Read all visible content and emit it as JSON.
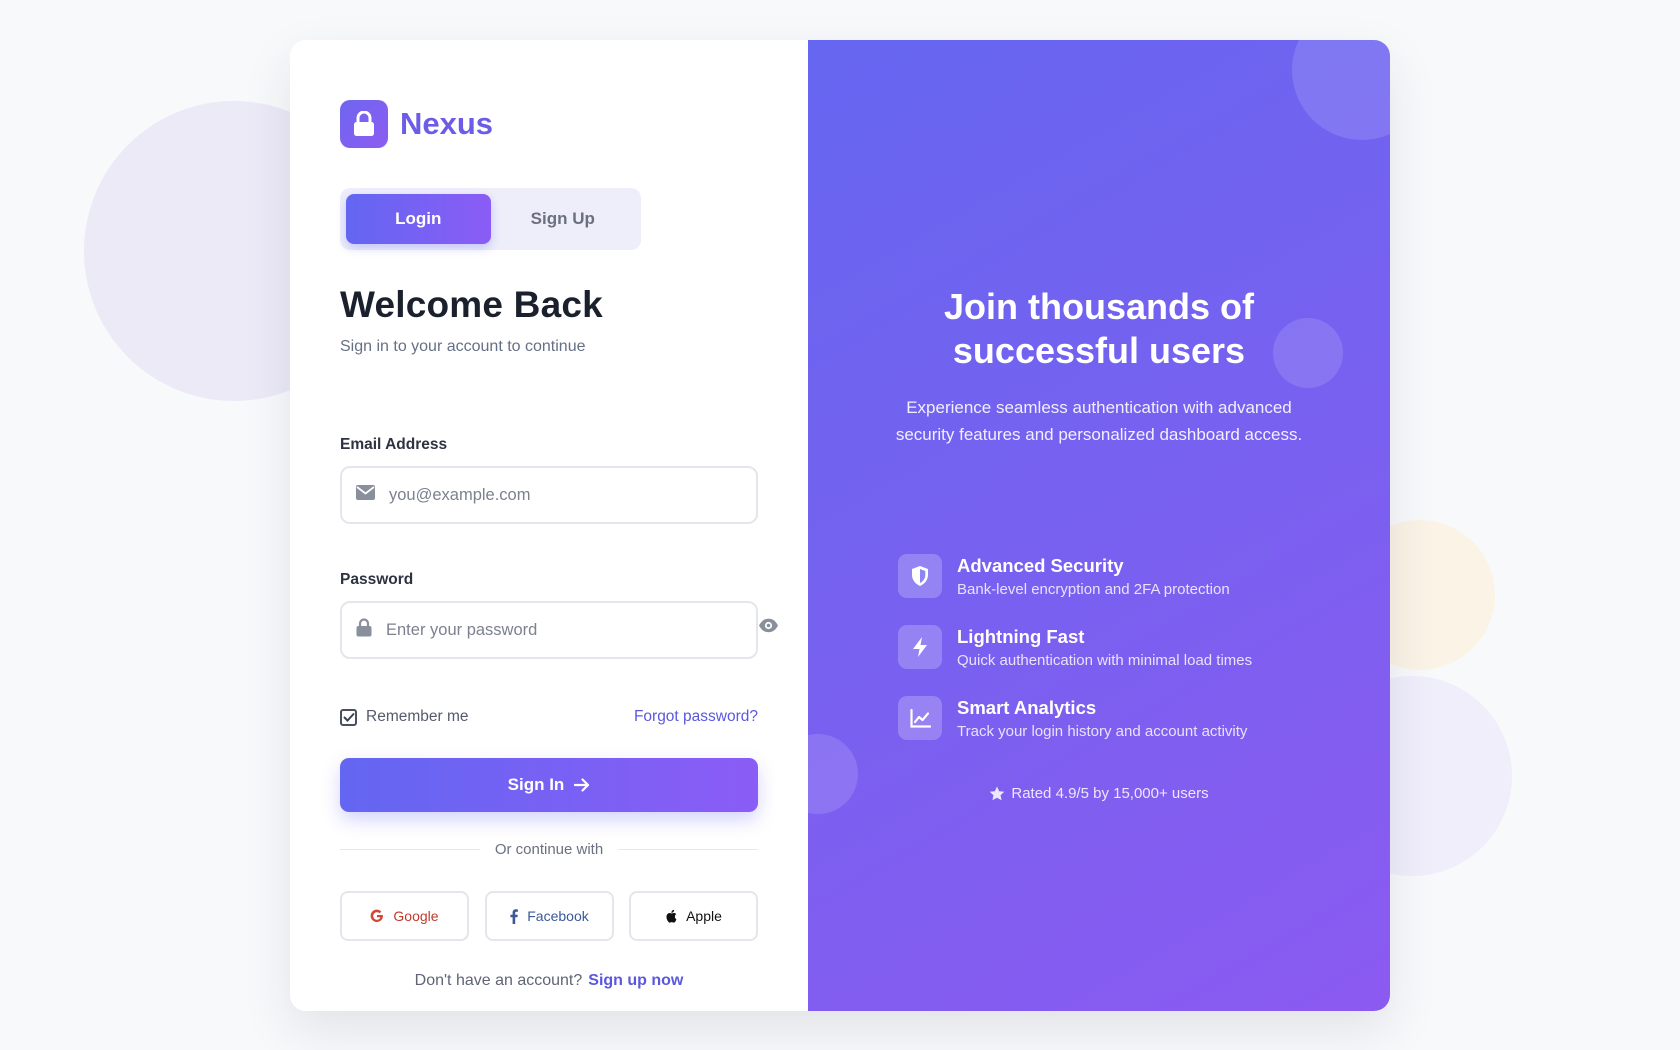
{
  "brand": {
    "name": "Nexus"
  },
  "tabs": [
    {
      "label": "Login",
      "active": true
    },
    {
      "label": "Sign Up",
      "active": false
    }
  ],
  "login": {
    "title": "Welcome Back",
    "subtitle": "Sign in to your account to continue",
    "email": {
      "label": "Email Address",
      "placeholder": "you@example.com",
      "value": ""
    },
    "password": {
      "label": "Password",
      "placeholder": "Enter your password",
      "value": ""
    },
    "remember_label": "Remember me",
    "remember_checked": true,
    "forgot_label": "Forgot password?",
    "signin_label": "Sign In",
    "divider_label": "Or continue with",
    "social": {
      "google": "Google",
      "facebook": "Facebook",
      "apple": "Apple"
    },
    "footer_prompt": "Don't have an account?",
    "footer_link": "Sign up now"
  },
  "promo": {
    "title_line1": "Join thousands of",
    "title_line2": "successful users",
    "description": "Experience seamless authentication with advanced security features and personalized dashboard access.",
    "features": [
      {
        "icon": "shield-icon",
        "title": "Advanced Security",
        "desc": "Bank-level encryption and 2FA protection"
      },
      {
        "icon": "bolt-icon",
        "title": "Lightning Fast",
        "desc": "Quick authentication with minimal load times"
      },
      {
        "icon": "chart-line-icon",
        "title": "Smart Analytics",
        "desc": "Track your login history and account activity"
      }
    ],
    "rating": "Rated 4.9/5 by 15,000+ users"
  },
  "colors": {
    "accent": "#6366f1",
    "accent_end": "#8b5cf6",
    "link": "#5b58dd"
  }
}
